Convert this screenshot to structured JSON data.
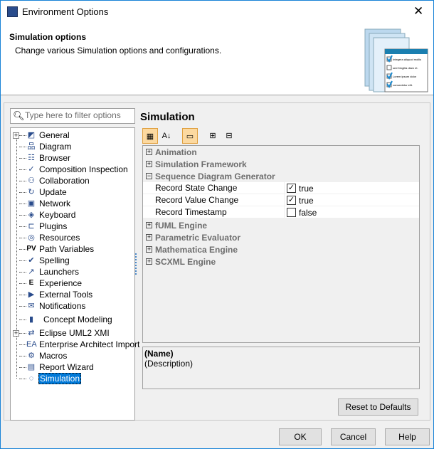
{
  "window": {
    "title": "Environment Options",
    "close_icon": "close-icon"
  },
  "header": {
    "title": "Simulation options",
    "subtitle": "Change various Simulation options and configurations.",
    "art_lines": [
      "Integera aliquod mollis",
      "sed fringilla diam et.",
      "Lorem ipsum dolor",
      "consectetur elit."
    ]
  },
  "filter": {
    "placeholder": "Type here to filter options",
    "value": ""
  },
  "tree": {
    "items": [
      {
        "label": "General",
        "icon": "general-icon",
        "expandable": true
      },
      {
        "label": "Diagram",
        "icon": "diagram-icon"
      },
      {
        "label": "Browser",
        "icon": "browser-icon"
      },
      {
        "label": "Composition Inspection",
        "icon": "composition-icon"
      },
      {
        "label": "Collaboration",
        "icon": "collaboration-icon"
      },
      {
        "label": "Update",
        "icon": "update-icon"
      },
      {
        "label": "Network",
        "icon": "network-icon"
      },
      {
        "label": "Keyboard",
        "icon": "keyboard-icon"
      },
      {
        "label": "Plugins",
        "icon": "plugin-icon"
      },
      {
        "label": "Resources",
        "icon": "resources-icon"
      },
      {
        "label": "Path Variables",
        "icon": "pv-icon"
      },
      {
        "label": "Spelling",
        "icon": "spelling-icon"
      },
      {
        "label": "Launchers",
        "icon": "launcher-icon"
      },
      {
        "label": "Experience",
        "icon": "experience-icon"
      },
      {
        "label": "External Tools",
        "icon": "external-tools-icon"
      },
      {
        "label": "Notifications",
        "icon": "envelope-icon"
      },
      {
        "label": "Concept Modeling",
        "icon": "concept-modeling-icon"
      },
      {
        "label": "Eclipse UML2 XMI",
        "icon": "arrows-icon",
        "expandable": true
      },
      {
        "label": "Enterprise Architect Import",
        "icon": "ea-icon"
      },
      {
        "label": "Macros",
        "icon": "gears-icon"
      },
      {
        "label": "Report Wizard",
        "icon": "report-icon"
      },
      {
        "label": "Simulation",
        "icon": "simulation-icon",
        "selected": true
      }
    ]
  },
  "main": {
    "title": "Simulation",
    "toolbar": [
      "categorized",
      "sort-alphabetical",
      "show-description",
      "expand-all",
      "collapse-all"
    ],
    "groups_before": [
      {
        "label": "Animation",
        "expanded": false
      },
      {
        "label": "Simulation Framework",
        "expanded": false
      },
      {
        "label": "Sequence Diagram Generator",
        "expanded": true
      }
    ],
    "properties": [
      {
        "name": "Record State Change",
        "checked": true,
        "value": "true"
      },
      {
        "name": "Record Value Change",
        "checked": true,
        "value": "true"
      },
      {
        "name": "Record Timestamp",
        "checked": false,
        "value": "false"
      }
    ],
    "groups_after": [
      {
        "label": "fUML Engine"
      },
      {
        "label": "Parametric Evaluator"
      },
      {
        "label": "Mathematica Engine"
      },
      {
        "label": "SCXML Engine"
      }
    ],
    "description": {
      "name": "(Name)",
      "text": "(Description)"
    },
    "reset_label": "Reset to Defaults"
  },
  "buttons": {
    "ok": "OK",
    "cancel": "Cancel",
    "help": "Help"
  },
  "colors": {
    "selection": "#0078d7",
    "toolbar_active": "#fcd9a0"
  }
}
